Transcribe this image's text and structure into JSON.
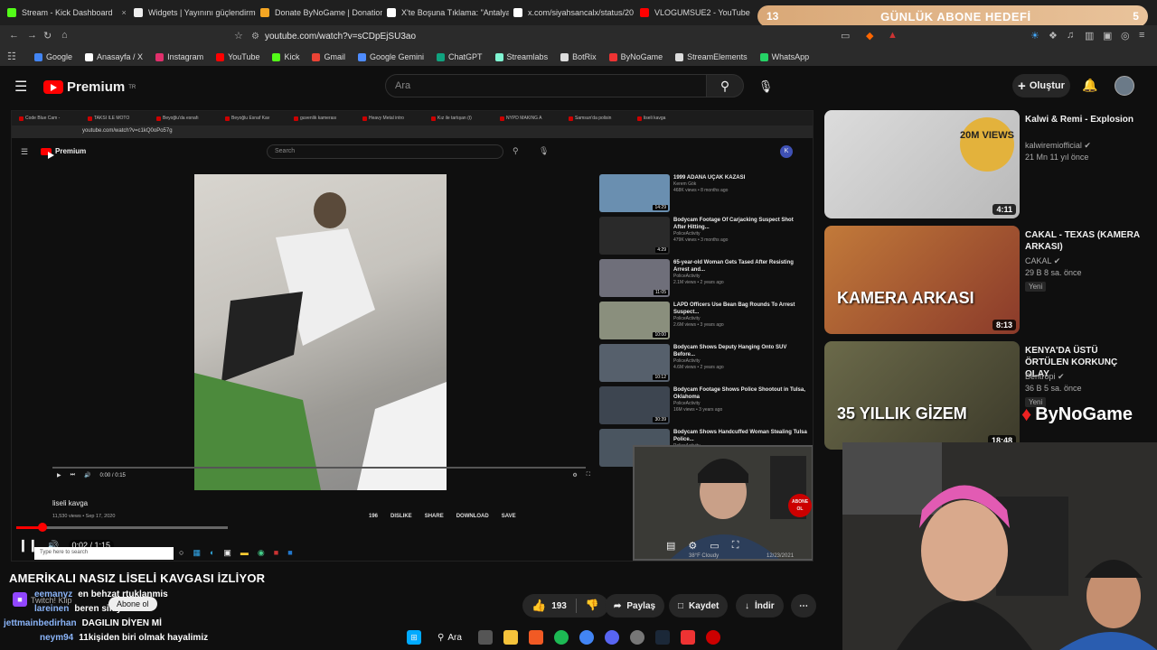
{
  "browser_tabs": [
    {
      "label": "Stream - Kick Dashboard",
      "color": "#53fc18"
    },
    {
      "label": "Widgets | Yayınını güçlendirme",
      "color": "#eee"
    },
    {
      "label": "Donate ByNoGame | Donation",
      "color": "#f5a623"
    },
    {
      "label": "X'te Boşuna Tıklama: \"Antalya",
      "color": "#fff"
    },
    {
      "label": "x.com/siyahsancalx/status/20",
      "color": "#fff"
    },
    {
      "label": "VLOGUMSUE2 - YouTube",
      "color": "#ff0000"
    }
  ],
  "goal": {
    "left": "13",
    "title": "GÜNLÜK ABONE HEDEFİ",
    "right": "5"
  },
  "url": "youtube.com/watch?v=sCDpEjSU3ao",
  "bookmarks": [
    "Google",
    "Anasayfa / X",
    "Instagram",
    "YouTube",
    "Kick",
    "Gmail",
    "Google Gemini",
    "ChatGPT",
    "Streamlabs",
    "BotRix",
    "ByNoGame",
    "StreamElements",
    "WhatsApp"
  ],
  "bookmark_colors": [
    "#4285f4",
    "#ffffff",
    "#e1306c",
    "#ff0000",
    "#53fc18",
    "#ea4335",
    "#4e8cff",
    "#10a37f",
    "#80f5d2",
    "#dddddd",
    "#e33",
    "#dddddd",
    "#25d366"
  ],
  "header": {
    "logo": "Premium",
    "region": "TR",
    "search_placeholder": "Ara",
    "create": "Oluştur"
  },
  "inner": {
    "tabs": [
      "Code Blue Cam -",
      "TAKSİ İLE MOTO",
      "Beyoğlu'da esnafı",
      "Beyoğlu Esnaf Kav",
      "guvenlik kamerası",
      "Heavy Metal intro",
      "Kız ile tartışan (t)",
      "NYPD MAKING A",
      "Samsun'da polisin",
      "liseli kavga"
    ],
    "url": "youtube.com/watch?v=c1kQ0oPo57g",
    "logo": "Premium",
    "search": "Search",
    "time": "0:00 / 0:15",
    "title": "liseli kavga",
    "meta": "11,530 views • Sep 17, 2020",
    "likes": "196",
    "dislike": "DISLIKE",
    "share": "SHARE",
    "download": "DOWNLOAD",
    "save": "SAVE",
    "recs": [
      {
        "title": "1999 ADANA UÇAK KAZASI",
        "channel": "Kerem Gök",
        "meta": "468K views • 8 months ago",
        "dur": "14:29",
        "color": "#6a8fb0"
      },
      {
        "title": "Bodycam Footage Of Carjacking Suspect Shot After Hitting...",
        "channel": "PoliceActivity",
        "meta": "479K views • 3 months ago",
        "dur": "4:29",
        "color": "#2a2a2a"
      },
      {
        "title": "65-year-old Woman Gets Tased After Resisting Arrest and...",
        "channel": "PoliceActivity",
        "meta": "2.1M views • 2 years ago",
        "dur": "11:05",
        "color": "#6f6f7a"
      },
      {
        "title": "LAPD Officers Use Bean Bag Rounds To Arrest Suspect...",
        "channel": "PoliceActivity",
        "meta": "2.6M views • 3 years ago",
        "dur": "10:00",
        "color": "#8a8f7d"
      },
      {
        "title": "Bodycam Shows Deputy Hanging Onto SUV Before...",
        "channel": "PoliceActivity",
        "meta": "4.6M views • 2 years ago",
        "dur": "10:12",
        "color": "#56606c"
      },
      {
        "title": "Bodycam Footage Shows Police Shootout in Tulsa, Oklahoma",
        "channel": "PoliceActivity",
        "meta": "16M views • 3 years ago",
        "dur": "30:39",
        "color": "#3d4550"
      },
      {
        "title": "Bodycam Shows Handcuffed Woman Stealing Tulsa Police...",
        "channel": "PoliceActivity",
        "meta": "",
        "dur": "",
        "color": "#4a5560"
      }
    ],
    "player_time": "0:02 / 1:15",
    "taskbar_search": "Type here to search",
    "weather": "38°F Cloudy",
    "clock": "12/23/2021"
  },
  "right_recs": [
    {
      "title": "Kalwi & Remi - Explosion",
      "channel": "kalwiremiofficial",
      "meta": "21 Mn  11 yıl önce",
      "dur": "4:11",
      "badge": "20M VIEWS",
      "new": ""
    },
    {
      "title": "CAKAL - TEXAS (KAMERA ARKASI)",
      "channel": "CAKAL",
      "meta": "29 B  8 sa. önce",
      "dur": "8:13",
      "badge": "KAMERA ARKASI",
      "new": "Yeni"
    },
    {
      "title": "KENYA'DA ÜSTÜ ÖRTÜLEN KORKUNÇ OLAY",
      "channel": "Bentropi",
      "meta": "36 B  5 sa. önce",
      "dur": "18:48",
      "badge": "35 YILLIK GİZEM",
      "new": "Yeni"
    }
  ],
  "overlay": {
    "title": "AMERİKALI  NASIZ LİSELİ KAVGASI İZLİYOR",
    "brand": "ByNoGame",
    "chat": [
      {
        "user": "eemanyz",
        "msg": "en behzat  rtuklanmis",
        "ucolor": "#8ab4f8"
      },
      {
        "user": "lareinen",
        "msg": "beren  sikiyor",
        "ucolor": "#8ab4f8"
      },
      {
        "user": "jettmainbedirhan",
        "msg": "DAGILIN DİYEN Mİ",
        "ucolor": "#8ab4f8"
      },
      {
        "user": "neym94",
        "msg": "11kişiden biri olmak hayalimiz",
        "ucolor": "#8ab4f8"
      }
    ],
    "follow": "Abone ol",
    "twitch": "Twitch! Klip"
  },
  "actions": {
    "likes": "193",
    "share": "Paylaş",
    "save": "Kaydet",
    "download": "İndir"
  },
  "taskbar": {
    "search": "Ara"
  },
  "webcam_overlay": {
    "abone": "ABONE OL"
  }
}
